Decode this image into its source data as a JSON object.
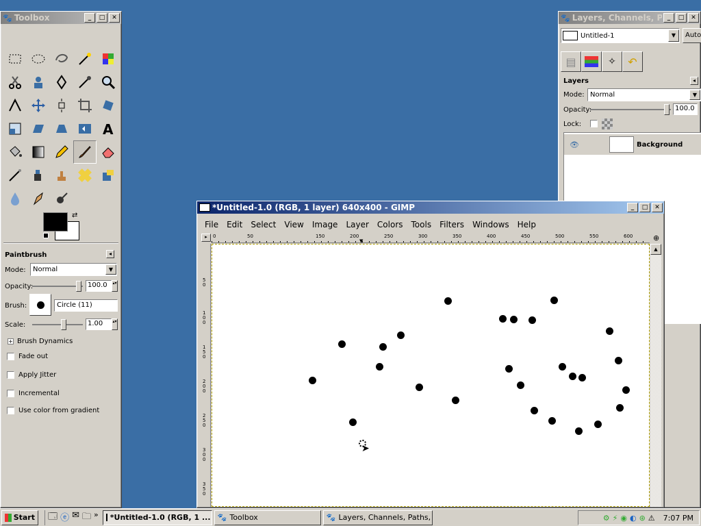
{
  "toolbox": {
    "title": "Toolbox",
    "tool_name": "Paintbrush",
    "mode_label": "Mode:",
    "mode_value": "Normal",
    "opacity_label": "Opacity:",
    "opacity_value": "100.0",
    "brush_label": "Brush:",
    "brush_value": "Circle (11)",
    "scale_label": "Scale:",
    "scale_value": "1.00",
    "brush_dynamics": "Brush Dynamics",
    "options": [
      "Fade out",
      "Apply Jitter",
      "Incremental",
      "Use color from gradient"
    ]
  },
  "layers": {
    "title": "Layers, Channels, Pat",
    "image_select": "Untitled-1",
    "auto_label": "Auto",
    "panel_title": "Layers",
    "mode_label": "Mode:",
    "mode_value": "Normal",
    "opacity_label": "Opacity:",
    "opacity_value": "100.0",
    "lock_label": "Lock:",
    "layer_name": "Background"
  },
  "image_window": {
    "title": "*Untitled-1.0 (RGB, 1 layer) 640x400 - GIMP",
    "menu": [
      "File",
      "Edit",
      "Select",
      "View",
      "Image",
      "Layer",
      "Colors",
      "Tools",
      "Filters",
      "Windows",
      "Help"
    ],
    "ruler_h": [
      "0",
      "50",
      "150",
      "200",
      "250",
      "300",
      "350",
      "400",
      "450",
      "500",
      "550",
      "600"
    ],
    "ruler_v": [
      "5\n0",
      "1\n0\n0",
      "1\n5\n0",
      "2\n0\n0",
      "2\n5\n0",
      "3\n0\n0",
      "3\n5\n0"
    ]
  },
  "taskbar": {
    "start": "Start",
    "tasks": [
      "*Untitled-1.0 (RGB, 1 ...",
      "Toolbox",
      "Layers, Channels, Paths, ..."
    ],
    "clock": "7:07 PM"
  },
  "colors": {
    "desktop": "#3a6ea5",
    "title_active": "#0a246a",
    "window": "#d4d0c8"
  }
}
